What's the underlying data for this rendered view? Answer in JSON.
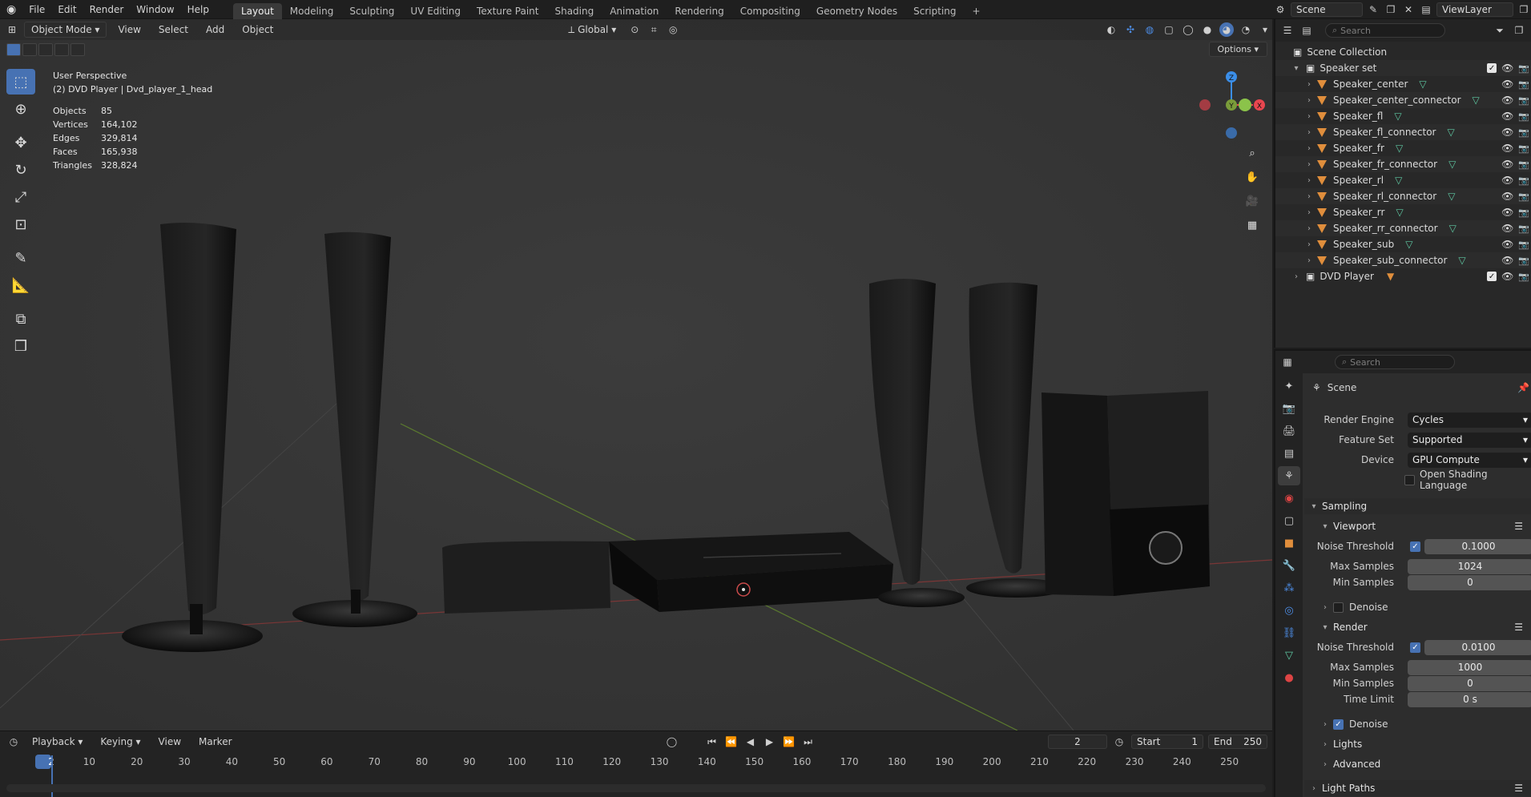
{
  "topbar": {
    "menus": [
      "File",
      "Edit",
      "Render",
      "Window",
      "Help"
    ],
    "workspaces": [
      "Layout",
      "Modeling",
      "Sculpting",
      "UV Editing",
      "Texture Paint",
      "Shading",
      "Animation",
      "Rendering",
      "Compositing",
      "Geometry Nodes",
      "Scripting"
    ],
    "add_tab": "+",
    "scene_name": "Scene",
    "view_layer": "ViewLayer"
  },
  "viewport": {
    "mode": "Object Mode",
    "menu": [
      "View",
      "Select",
      "Add",
      "Object"
    ],
    "orientation": "Global",
    "options": "Options",
    "perspective": "User Perspective",
    "active_object": "(2) DVD Player | Dvd_player_1_head",
    "stats": [
      {
        "label": "Objects",
        "value": "85"
      },
      {
        "label": "Vertices",
        "value": "164,102"
      },
      {
        "label": "Edges",
        "value": "329,814"
      },
      {
        "label": "Faces",
        "value": "165,938"
      },
      {
        "label": "Triangles",
        "value": "328,824"
      }
    ],
    "gizmo": {
      "z": "Z",
      "y": "Y",
      "x": "X"
    }
  },
  "timeline": {
    "menu": [
      "Playback",
      "Keying",
      "View",
      "Marker"
    ],
    "current_frame": "2",
    "start_label": "Start",
    "start": "1",
    "end_label": "End",
    "end": "250",
    "ticks": [
      "2",
      "10",
      "20",
      "30",
      "40",
      "50",
      "60",
      "70",
      "80",
      "90",
      "100",
      "110",
      "120",
      "130",
      "140",
      "150",
      "160",
      "170",
      "180",
      "190",
      "200",
      "210",
      "220",
      "230",
      "240",
      "250"
    ]
  },
  "outliner": {
    "search_placeholder": "Search",
    "root": "Scene Collection",
    "collection": "Speaker set",
    "items": [
      "Speaker_center",
      "Speaker_center_connector",
      "Speaker_fl",
      "Speaker_fl_connector",
      "Speaker_fr",
      "Speaker_fr_connector",
      "Speaker_rl",
      "Speaker_rl_connector",
      "Speaker_rr",
      "Speaker_rr_connector",
      "Speaker_sub",
      "Speaker_sub_connector"
    ],
    "collection2": "DVD Player"
  },
  "properties": {
    "search_placeholder": "Search",
    "context": "Scene",
    "render_engine_label": "Render Engine",
    "render_engine": "Cycles",
    "feature_set_label": "Feature Set",
    "feature_set": "Supported",
    "device_label": "Device",
    "device": "GPU Compute",
    "osl_label": "Open Shading Language",
    "sampling": "Sampling",
    "viewport_section": "Viewport",
    "noise_threshold_label": "Noise Threshold",
    "vp_noise_threshold": "0.1000",
    "max_samples_label": "Max Samples",
    "vp_max_samples": "1024",
    "min_samples_label": "Min Samples",
    "vp_min_samples": "0",
    "denoise_label": "Denoise",
    "render_section": "Render",
    "r_noise_threshold": "0.0100",
    "r_max_samples": "1000",
    "r_min_samples": "0",
    "time_limit_label": "Time Limit",
    "time_limit": "0 s",
    "lights": "Lights",
    "advanced": "Advanced",
    "light_paths": "Light Paths"
  },
  "colors": {
    "accent": "#4772b3",
    "object_orange": "#e08e3c",
    "mesh_green": "#5fc9a3",
    "axis_x": "#e8464f",
    "axis_y": "#8bc34a",
    "axis_z": "#3b8ee8"
  }
}
